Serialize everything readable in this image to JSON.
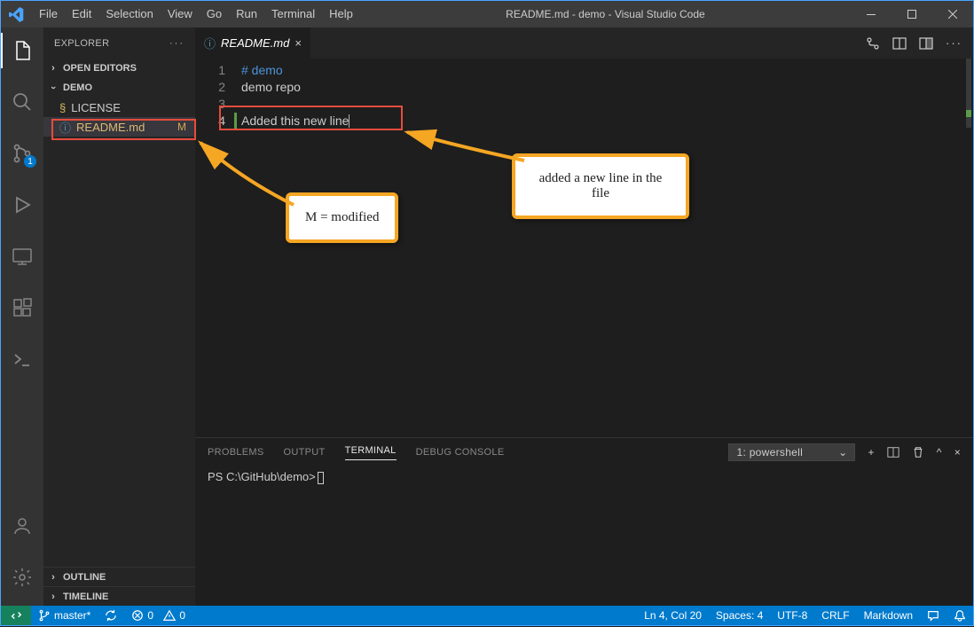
{
  "titlebar": {
    "menus": [
      "File",
      "Edit",
      "Selection",
      "View",
      "Go",
      "Run",
      "Terminal",
      "Help"
    ],
    "title": "README.md - demo - Visual Studio Code"
  },
  "activitybar": {
    "scm_badge": "1"
  },
  "sidebar": {
    "title": "EXPLORER",
    "open_editors": "OPEN EDITORS",
    "folder": "DEMO",
    "files": [
      {
        "name": "LICENSE",
        "icon": "cert",
        "status": ""
      },
      {
        "name": "README.md",
        "icon": "info",
        "status": "M",
        "selected": true
      }
    ],
    "outline": "OUTLINE",
    "timeline": "TIMELINE"
  },
  "tab": {
    "name": "README.md"
  },
  "editor": {
    "lines": [
      {
        "n": "1",
        "text": "# demo",
        "cls": "l1"
      },
      {
        "n": "2",
        "text": "demo repo",
        "cls": ""
      },
      {
        "n": "3",
        "text": "",
        "cls": ""
      },
      {
        "n": "4",
        "text": "Added this new line",
        "cls": "",
        "git": true,
        "caret": true
      }
    ]
  },
  "annotations": {
    "left": "M = modified",
    "right": "added a new line in the\nfile"
  },
  "panel": {
    "tabs": [
      "PROBLEMS",
      "OUTPUT",
      "TERMINAL",
      "DEBUG CONSOLE"
    ],
    "active": "TERMINAL",
    "dropdown": "1: powershell",
    "prompt": "PS C:\\GitHub\\demo>"
  },
  "statusbar": {
    "branch": "master*",
    "sync": "",
    "errors": "0",
    "warnings": "0",
    "ln_col": "Ln 4, Col 20",
    "spaces": "Spaces: 4",
    "encoding": "UTF-8",
    "eol": "CRLF",
    "lang": "Markdown"
  }
}
